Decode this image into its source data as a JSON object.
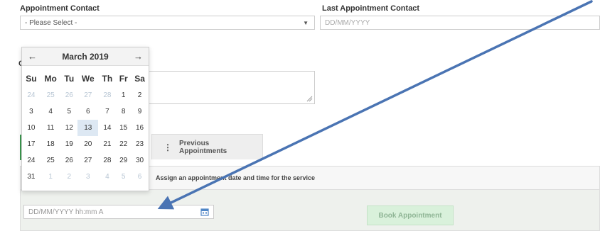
{
  "form": {
    "appointment_contact_label": "Appointment Contact",
    "appointment_contact_value": "- Please Select -",
    "last_appointment_label": "Last Appointment Contact",
    "last_appointment_placeholder": "DD/MM/YYYY",
    "comments_label_partial": "C"
  },
  "tabs": {
    "previous_label": "Previous Appointments"
  },
  "panel": {
    "instruction": "Assign an appointment date and time for the service",
    "datetime_placeholder": "DD/MM/YYYY hh:mm A",
    "book_label": "Book Appointment"
  },
  "calendar": {
    "prev": "←",
    "next": "→",
    "title": "March 2019",
    "weekdays": [
      "Su",
      "Mo",
      "Tu",
      "We",
      "Th",
      "Fr",
      "Sa"
    ],
    "weeks": [
      [
        "24",
        "25",
        "26",
        "27",
        "28",
        "1",
        "2"
      ],
      [
        "3",
        "4",
        "5",
        "6",
        "7",
        "8",
        "9"
      ],
      [
        "10",
        "11",
        "12",
        "13",
        "14",
        "15",
        "16"
      ],
      [
        "17",
        "18",
        "19",
        "20",
        "21",
        "22",
        "23"
      ],
      [
        "24",
        "25",
        "26",
        "27",
        "28",
        "29",
        "30"
      ],
      [
        "31",
        "1",
        "2",
        "3",
        "4",
        "5",
        "6"
      ]
    ],
    "today": "13"
  },
  "annotation": {
    "arrow_color": "#4a74b3"
  }
}
